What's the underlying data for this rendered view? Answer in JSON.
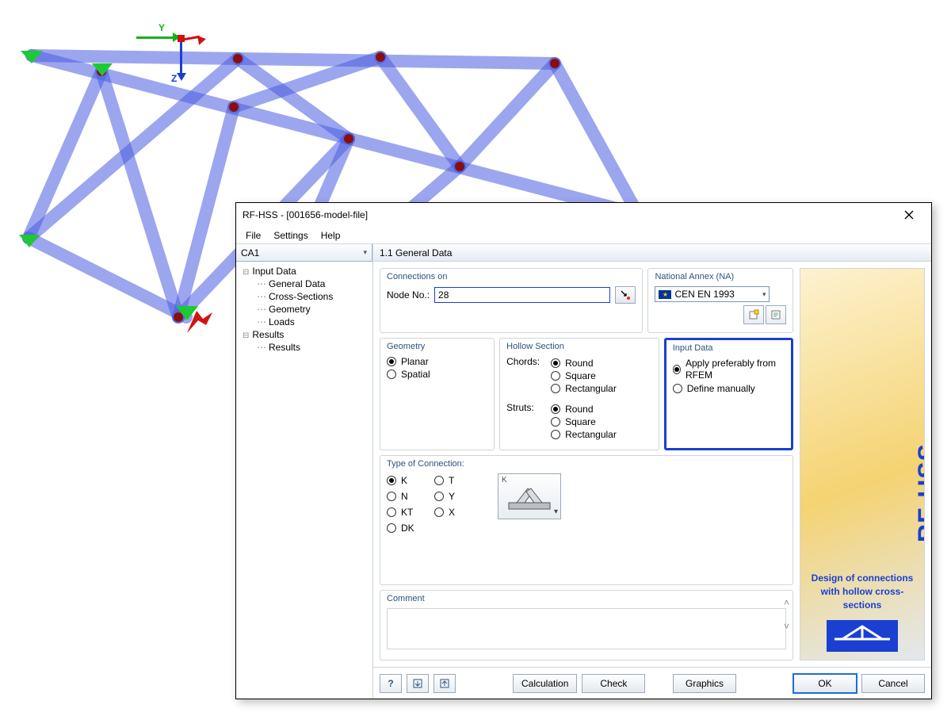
{
  "axis": {
    "y": "Y",
    "z": "Z"
  },
  "dialog": {
    "title": "RF-HSS - [001656-model-file]",
    "menu": {
      "file": "File",
      "settings": "Settings",
      "help": "Help"
    },
    "case_combo": "CA1",
    "tree": {
      "input_data": "Input Data",
      "general_data": "General Data",
      "cross_sections": "Cross-Sections",
      "geometry": "Geometry",
      "loads": "Loads",
      "results": "Results",
      "results_leaf": "Results"
    },
    "section_header": "1.1 General Data",
    "connections_on": {
      "legend": "Connections on",
      "node_label": "Node  No.:",
      "node_value": "28"
    },
    "annex": {
      "legend": "National Annex (NA)",
      "value": "CEN EN 1993"
    },
    "geometry": {
      "legend": "Geometry",
      "planar": "Planar",
      "spatial": "Spatial"
    },
    "hollow": {
      "legend": "Hollow Section",
      "chords": "Chords:",
      "struts": "Struts:",
      "round": "Round",
      "square": "Square",
      "rect": "Rectangular"
    },
    "input_data_box": {
      "legend": "Input Data",
      "rfem": "Apply preferably from RFEM",
      "manual": "Define manually"
    },
    "conn_type": {
      "legend": "Type of Connection:",
      "K": "K",
      "T": "T",
      "N": "N",
      "Y": "Y",
      "KT": "KT",
      "X": "X",
      "DK": "DK",
      "preview_letter": "K"
    },
    "brand": {
      "name": "RF-HSS",
      "tag1": "Design of connections",
      "tag2": "with hollow cross-sections"
    },
    "comment": {
      "legend": "Comment",
      "value": ""
    },
    "buttons": {
      "calc": "Calculation",
      "check": "Check",
      "graphics": "Graphics",
      "ok": "OK",
      "cancel": "Cancel"
    }
  }
}
